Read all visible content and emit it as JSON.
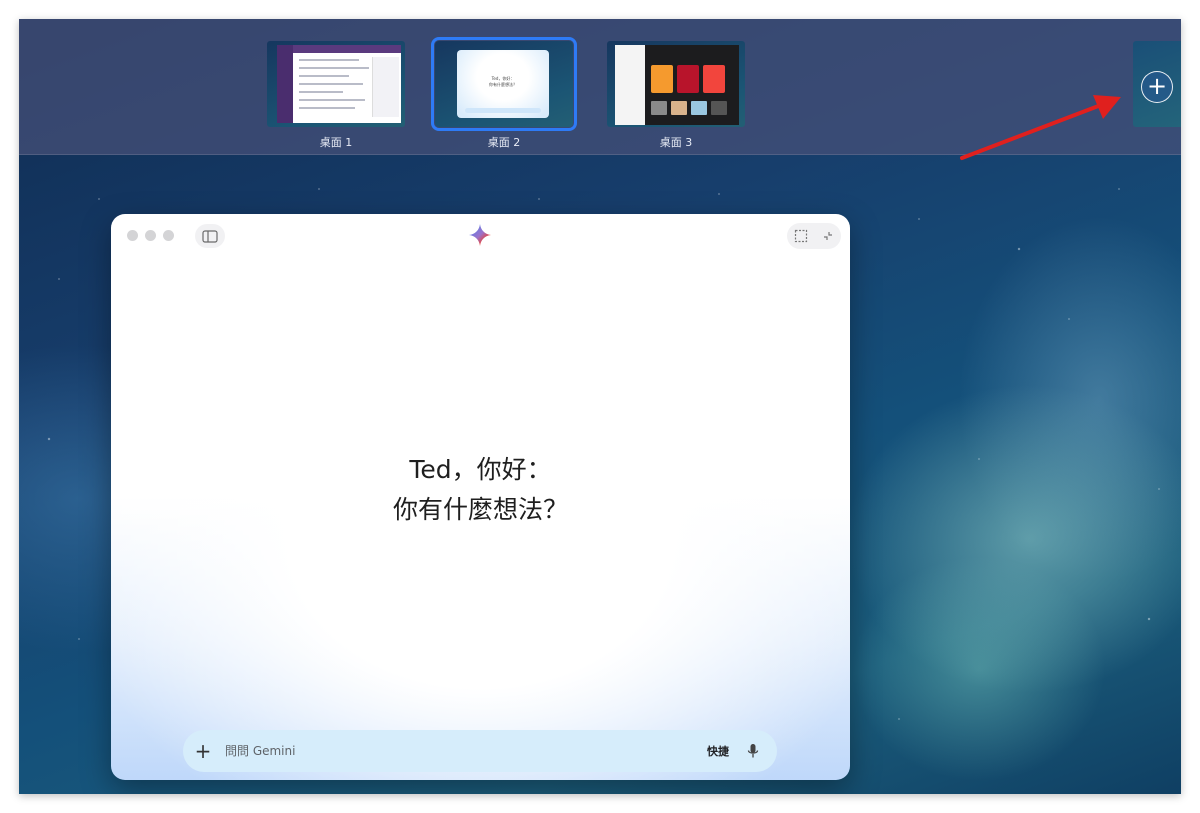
{
  "spaces": [
    {
      "label": "桌面 1",
      "active": false
    },
    {
      "label": "桌面 2",
      "active": true
    },
    {
      "label": "桌面 3",
      "active": false
    }
  ],
  "add_space_icon": "plus-icon",
  "annotation_color": "#e0201e",
  "accent_color": "#2e7bf6",
  "gemini": {
    "greeting_line1": "Ted，你好：",
    "greeting_line2": "你有什麼想法？",
    "input_placeholder": "問問 Gemini",
    "shortcut_label": "快捷",
    "icons": {
      "sidebar": "sidebar-icon",
      "logo": "gemini-spark-icon",
      "screenshot": "screenshot-icon",
      "collapse": "collapse-icon",
      "add": "plus-icon",
      "mic": "mic-icon"
    }
  }
}
